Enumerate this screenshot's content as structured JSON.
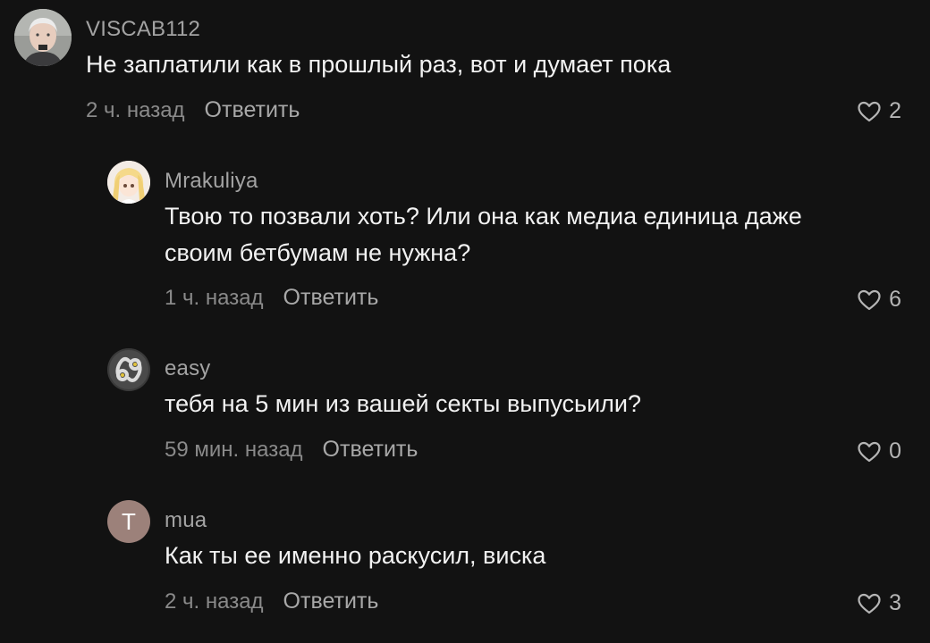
{
  "comments": [
    {
      "username": "VISCAB112",
      "text": "Не заплатили как в прошлый раз, вот и думает пока",
      "time": "2 ч. назад",
      "reply_label": "Ответить",
      "likes": "2",
      "avatar_icon": "user-photo-avatar"
    },
    {
      "username": "Mrakuliya",
      "text": "Твою то позвали хоть? Или она как медиа единица даже своим бетбумам не нужна?",
      "time": "1 ч. назад",
      "reply_label": "Ответить",
      "likes": "6",
      "avatar_icon": "anime-avatar"
    },
    {
      "username": "easy",
      "text": "тебя на 5 мин из вашей секты выпусьили?",
      "time": "59 мин. назад",
      "reply_label": "Ответить",
      "likes": "0",
      "avatar_icon": "69-logo-avatar"
    },
    {
      "username": "mua",
      "text": "Как ты ее именно раскусил, виска",
      "time": "2 ч. назад",
      "reply_label": "Ответить",
      "likes": "3",
      "avatar_letter": "T",
      "avatar_color": "#9c817a"
    }
  ]
}
